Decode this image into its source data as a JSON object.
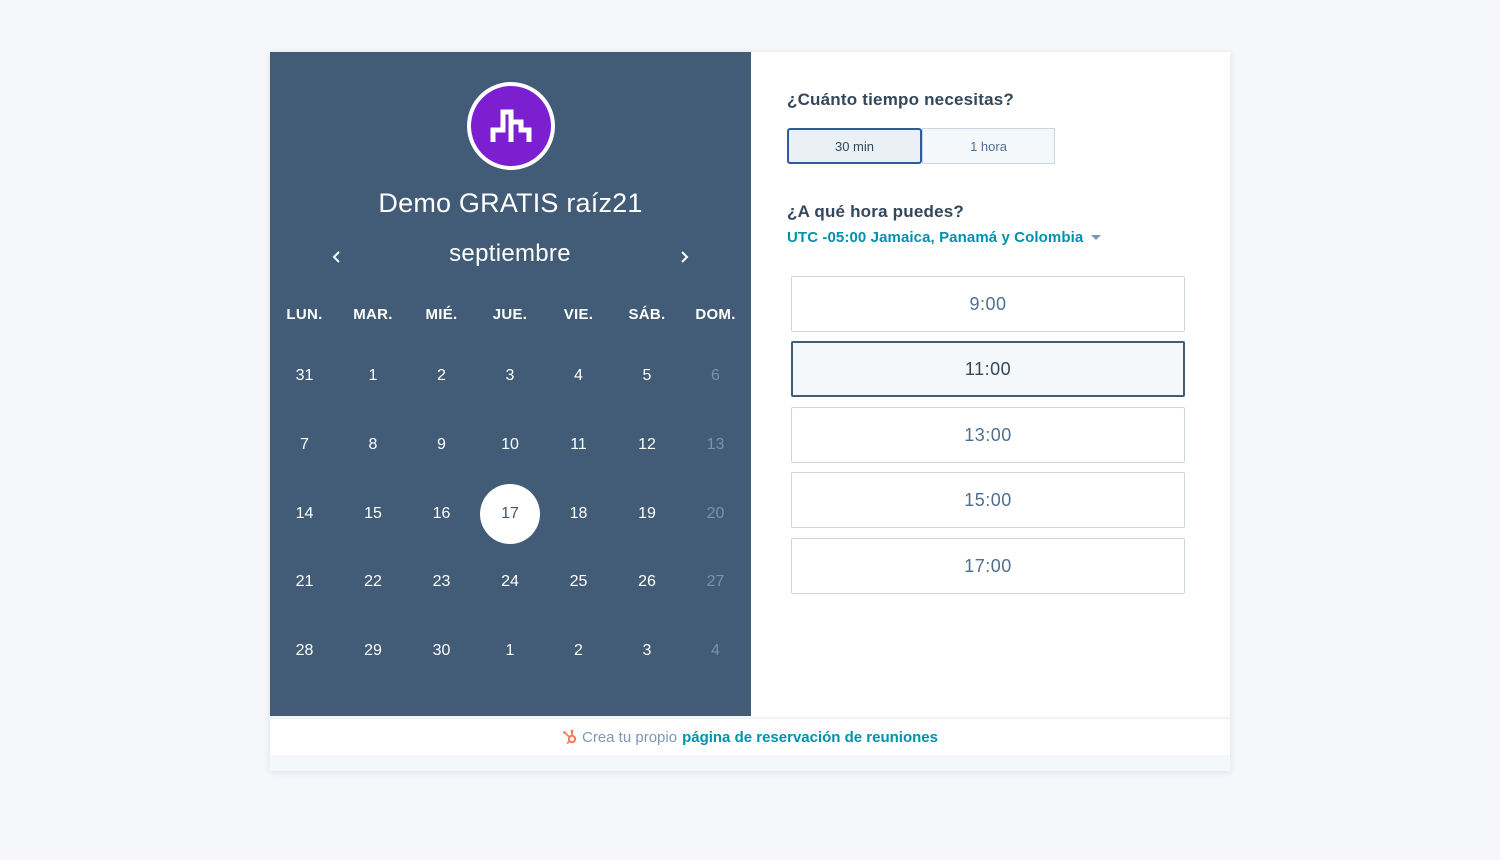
{
  "meeting": {
    "name": "Demo GRATIS raíz21"
  },
  "calendar": {
    "month": "septiembre",
    "weekdays": [
      "LUN.",
      "MAR.",
      "MIÉ.",
      "JUE.",
      "VIE.",
      "SÁB.",
      "DOM."
    ],
    "weeks": [
      [
        {
          "label": "31",
          "disabled": false,
          "selected": false
        },
        {
          "label": "1",
          "disabled": false,
          "selected": false
        },
        {
          "label": "2",
          "disabled": false,
          "selected": false
        },
        {
          "label": "3",
          "disabled": false,
          "selected": false
        },
        {
          "label": "4",
          "disabled": false,
          "selected": false
        },
        {
          "label": "5",
          "disabled": false,
          "selected": false
        },
        {
          "label": "6",
          "disabled": true,
          "selected": false
        }
      ],
      [
        {
          "label": "7",
          "disabled": false,
          "selected": false
        },
        {
          "label": "8",
          "disabled": false,
          "selected": false
        },
        {
          "label": "9",
          "disabled": false,
          "selected": false
        },
        {
          "label": "10",
          "disabled": false,
          "selected": false
        },
        {
          "label": "11",
          "disabled": false,
          "selected": false
        },
        {
          "label": "12",
          "disabled": false,
          "selected": false
        },
        {
          "label": "13",
          "disabled": true,
          "selected": false
        }
      ],
      [
        {
          "label": "14",
          "disabled": false,
          "selected": false
        },
        {
          "label": "15",
          "disabled": false,
          "selected": false
        },
        {
          "label": "16",
          "disabled": false,
          "selected": false
        },
        {
          "label": "17",
          "disabled": false,
          "selected": true
        },
        {
          "label": "18",
          "disabled": false,
          "selected": false
        },
        {
          "label": "19",
          "disabled": false,
          "selected": false
        },
        {
          "label": "20",
          "disabled": true,
          "selected": false
        }
      ],
      [
        {
          "label": "21",
          "disabled": false,
          "selected": false
        },
        {
          "label": "22",
          "disabled": false,
          "selected": false
        },
        {
          "label": "23",
          "disabled": false,
          "selected": false
        },
        {
          "label": "24",
          "disabled": false,
          "selected": false
        },
        {
          "label": "25",
          "disabled": false,
          "selected": false
        },
        {
          "label": "26",
          "disabled": false,
          "selected": false
        },
        {
          "label": "27",
          "disabled": true,
          "selected": false
        }
      ],
      [
        {
          "label": "28",
          "disabled": false,
          "selected": false
        },
        {
          "label": "29",
          "disabled": false,
          "selected": false
        },
        {
          "label": "30",
          "disabled": false,
          "selected": false
        },
        {
          "label": "1",
          "disabled": false,
          "selected": false
        },
        {
          "label": "2",
          "disabled": false,
          "selected": false
        },
        {
          "label": "3",
          "disabled": false,
          "selected": false
        },
        {
          "label": "4",
          "disabled": true,
          "selected": false
        }
      ]
    ]
  },
  "duration": {
    "label": "¿Cuánto tiempo necesitas?",
    "options": [
      {
        "label": "30 min",
        "selected": true
      },
      {
        "label": "1 hora",
        "selected": false
      }
    ]
  },
  "time": {
    "label": "¿A qué hora puedes?",
    "timezone": "UTC -05:00 Jamaica, Panamá y Colombia",
    "slots": [
      {
        "label": "9:00",
        "selected": false
      },
      {
        "label": "11:00",
        "selected": true
      },
      {
        "label": "13:00",
        "selected": false
      },
      {
        "label": "15:00",
        "selected": false
      },
      {
        "label": "17:00",
        "selected": false
      }
    ]
  },
  "footer": {
    "prefix": "Crea tu propio",
    "link": "página de reservación de reuniones"
  },
  "icons": {
    "logo": "company-logo-icon",
    "prev": "chevron-left-icon",
    "next": "chevron-right-icon",
    "timezone_caret": "caret-down-icon",
    "hubspot": "hubspot-sprocket-icon"
  },
  "colors": {
    "calendar_panel": "#425b76",
    "logo_purple": "#7c1fd1",
    "link_teal": "#0091ae",
    "hubspot_orange": "#ff7a59"
  }
}
